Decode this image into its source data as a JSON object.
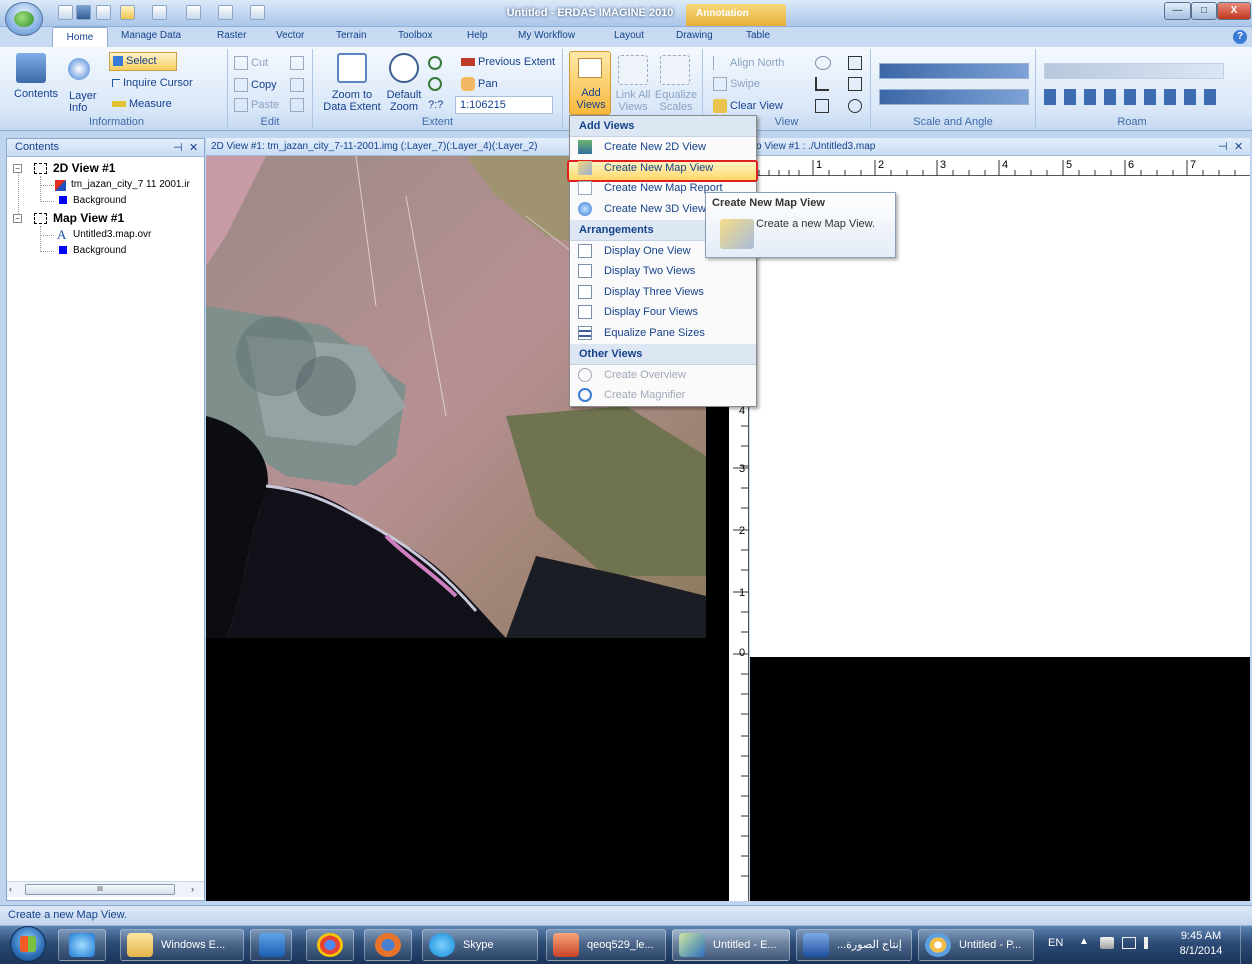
{
  "window": {
    "title": "Untitled - ERDAS IMAGINE 2010",
    "context_tab": "Annotation",
    "minimize": "—",
    "maximize": "□",
    "close": "X"
  },
  "ribbon_tabs": [
    "Home",
    "Manage Data",
    "Raster",
    "Vector",
    "Terrain",
    "Toolbox",
    "Help",
    "My Workflow",
    "Layout",
    "Drawing",
    "Table"
  ],
  "help_label": "?",
  "ribbon": {
    "information": {
      "label": "Information",
      "contents": "Contents",
      "layer_info": "Layer Info",
      "select": "Select",
      "inquire_cursor": "Inquire Cursor",
      "measure": "Measure"
    },
    "edit": {
      "label": "Edit",
      "cut": "Cut",
      "copy": "Copy",
      "paste": "Paste"
    },
    "extent": {
      "label": "Extent",
      "zoom_to_data_extent": "Zoom to Data Extent",
      "default_zoom": "Default Zoom",
      "previous_extent": "Previous Extent",
      "pan": "Pan",
      "scale_prefix": "?:?",
      "scale_value": "1:106215"
    },
    "views": {
      "add_views": "Add Views",
      "link_all_views": "Link All Views",
      "equalize_scales": "Equalize Scales"
    },
    "view": {
      "label": "View",
      "align_north": "Align North",
      "swipe": "Swipe",
      "clear_view": "Clear View"
    },
    "scale_angle": {
      "label": "Scale and Angle"
    },
    "roam": {
      "label": "Roam"
    }
  },
  "contents_panel": {
    "title": "Contents",
    "pin": "⊣",
    "close": "✕",
    "tree": [
      {
        "label": "2D View #1",
        "children": [
          "tm_jazan_city_7 11 2001.ir",
          "Background"
        ]
      },
      {
        "label": "Map View #1",
        "children": [
          "Untitled3.map.ovr",
          "Background"
        ]
      }
    ],
    "scroll_mid": "III"
  },
  "view2d": {
    "title": "2D View #1: tm_jazan_city_7-11-2001.img (:Layer_7)(:Layer_4)(:Layer_2)"
  },
  "map_view": {
    "title": "o View #1 : ./Untitled3.map",
    "pin": "⊣",
    "close": "✕",
    "ruler_top": [
      "1",
      "2",
      "3",
      "4",
      "5",
      "6",
      "7"
    ],
    "ruler_left": [
      "4",
      "3",
      "2",
      "1",
      "0"
    ]
  },
  "menu": {
    "add_views_header": "Add Views",
    "add_views": [
      "Create New 2D View",
      "Create New Map View",
      "Create New Map Report",
      "Create New 3D View"
    ],
    "arrangements_header": "Arrangements",
    "arrangements": [
      "Display One View",
      "Display Two Views",
      "Display Three Views",
      "Display Four Views",
      "Equalize Pane Sizes"
    ],
    "other_header": "Other Views",
    "other": [
      "Create Overview",
      "Create Magnifier"
    ]
  },
  "tooltip": {
    "title": "Create New Map View",
    "body": "Create a new Map View."
  },
  "status_text": "Create a new Map View.",
  "taskbar": {
    "items": [
      "Windows E...",
      "Skype",
      "qeoq529_le...",
      "Untitled - E...",
      "...إنتاج الصورة",
      "Untitled - P..."
    ],
    "lang": "EN",
    "time": "9:45 AM",
    "date": "8/1/2014"
  },
  "colors": {
    "highlight_border": "#e02020",
    "ribbon_text": "#15428b",
    "context_tab": "#e5b03b"
  }
}
